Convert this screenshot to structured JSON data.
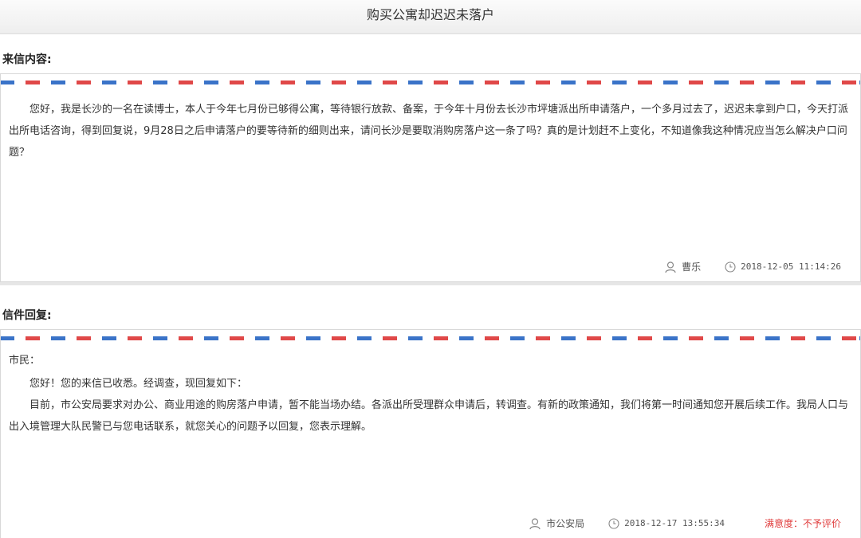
{
  "page": {
    "title": "购买公寓却迟迟未落户"
  },
  "letter": {
    "section_label": "来信内容:",
    "content": "您好，我是长沙的一名在读博士，本人于今年七月份已够得公寓，等待银行放款、备案，于今年十月份去长沙市坪塘派出所申请落户，一个多月过去了，迟迟未拿到户口，今天打派出所电话咨询，得到回复说，9月28日之后申请落户的要等待新的细则出来，请问长沙是要取消购房落户这一条了吗？真的是计划赶不上变化，不知道像我这种情况应当怎么解决户口问题？",
    "author": "曹乐",
    "time": "2018-12-05 11:14:26",
    "user_icon": "user-icon",
    "clock_icon": "clock-icon"
  },
  "reply": {
    "section_label": "信件回复:",
    "salutation": "市民：",
    "paragraph1": "您好！您的来信已收悉。经调查，现回复如下：",
    "paragraph2": "目前，市公安局要求对办公、商业用途的购房落户申请，暂不能当场办结。各派出所受理群众申请后，转调查。有新的政策通知，我们将第一时间通知您开展后续工作。我局人口与出入境管理大队民警已与您电话联系，就您关心的问题予以回复，您表示理解。",
    "author": "市公安局",
    "time": "2018-12-17 13:55:34",
    "satisfaction": "满意度：不予评价",
    "user_icon": "user-icon",
    "clock_icon": "clock-icon"
  },
  "colors": {
    "stripe_blue": "#3a73c8",
    "stripe_red": "#e04848",
    "satisfaction": "#e03c3c"
  }
}
